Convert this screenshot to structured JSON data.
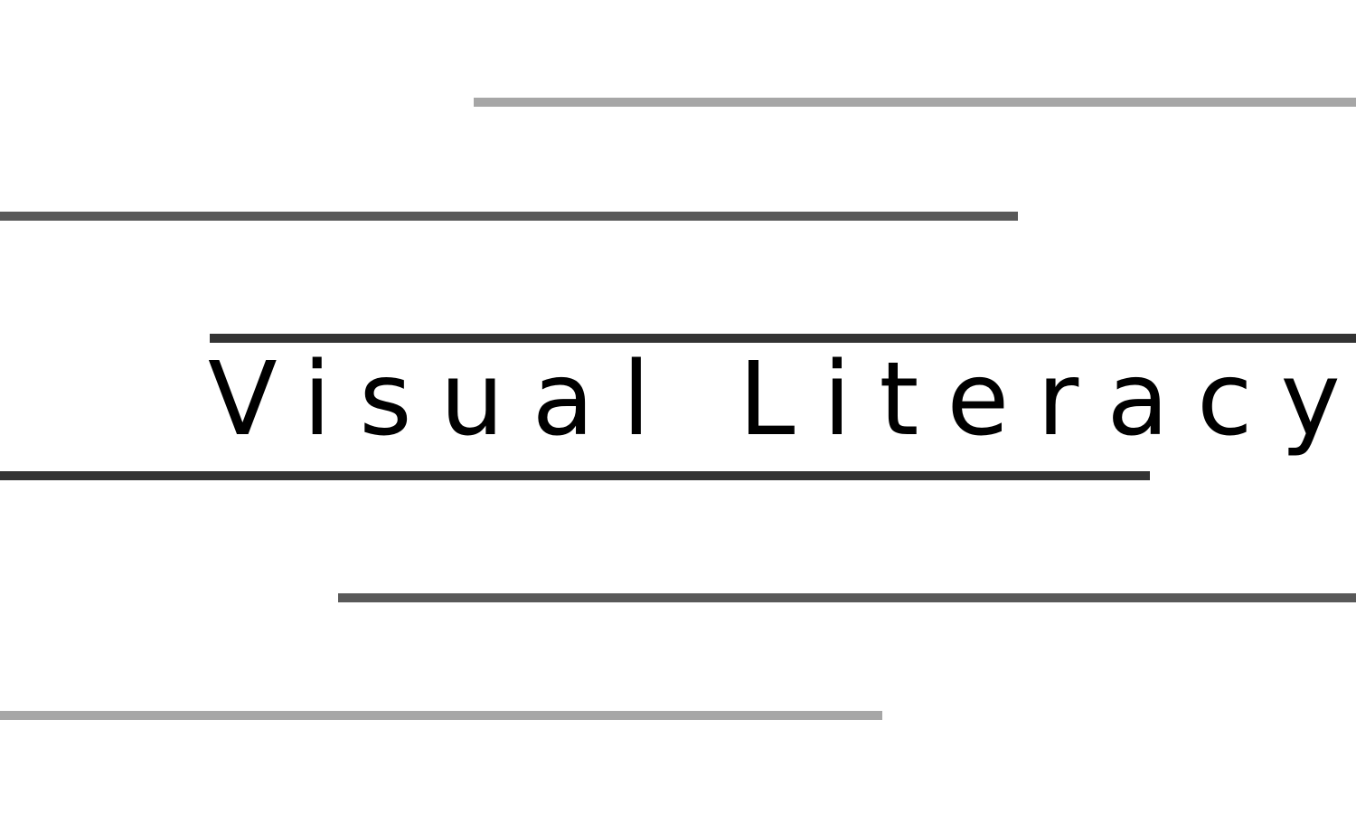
{
  "title": "Visual Literacy",
  "colors": {
    "background": "#ffffff",
    "text": "#000000",
    "light_line": "#a6a6a6",
    "mid_line": "#595959",
    "dark_line": "#333333"
  },
  "lines": [
    {
      "name": "line-top",
      "color": "#a6a6a6"
    },
    {
      "name": "line-second",
      "color": "#595959"
    },
    {
      "name": "line-above-title",
      "color": "#333333"
    },
    {
      "name": "line-below-title",
      "color": "#333333"
    },
    {
      "name": "line-fifth",
      "color": "#595959"
    },
    {
      "name": "line-bottom",
      "color": "#a6a6a6"
    }
  ]
}
